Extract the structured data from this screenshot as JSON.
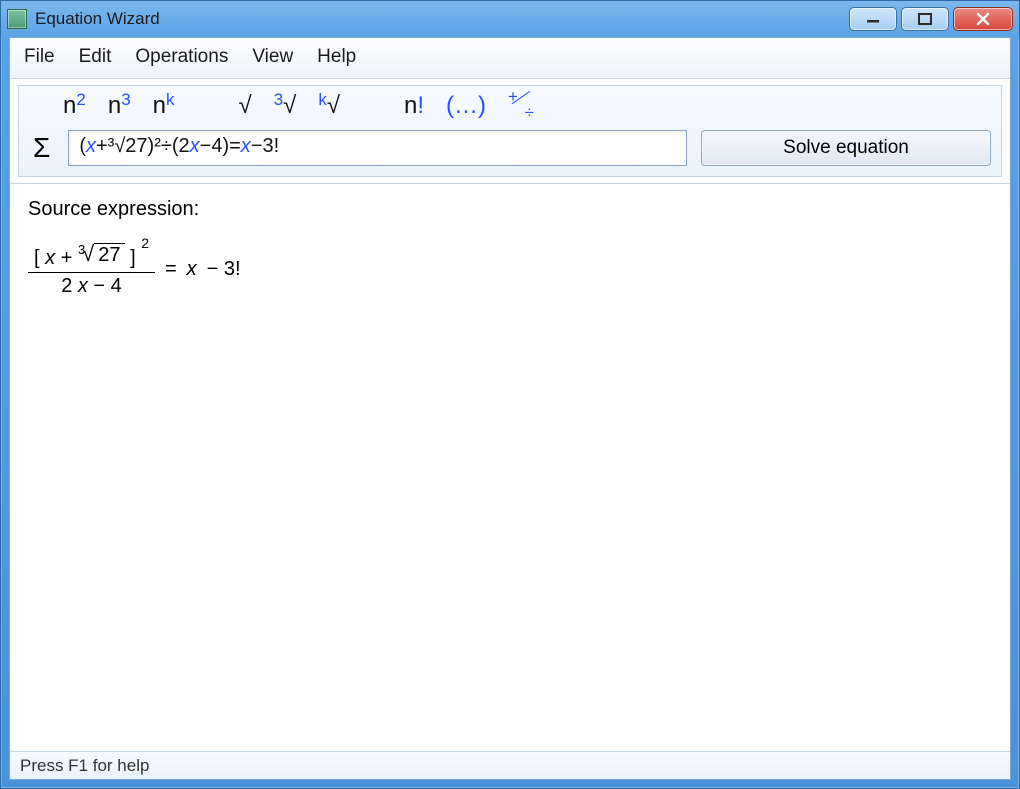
{
  "window": {
    "title": "Equation Wizard"
  },
  "menu": {
    "file": "File",
    "edit": "Edit",
    "operations": "Operations",
    "view": "View",
    "help": "Help"
  },
  "toolbar": {
    "n_square_base": "n",
    "n_square_exp": "2",
    "n_cube_base": "n",
    "n_cube_exp": "3",
    "n_k_base": "n",
    "n_k_exp": "k",
    "sqrt_symbol": "√",
    "cbrt_deg": "3",
    "cbrt_symbol": "√",
    "kroot_deg": "k",
    "kroot_symbol": "√",
    "factorial": "n!",
    "parens": "(…)",
    "ops_plus": "+",
    "ops_div": "÷",
    "ops_minus": "−",
    "sigma": "Σ",
    "solve_label": "Solve equation"
  },
  "input": {
    "pre_x": "(",
    "x1": "x",
    "mid1": "+³√27)²÷(2",
    "x2": "x",
    "mid2": "−4)=",
    "x3": "x",
    "tail": "−3!"
  },
  "content": {
    "source_label": "Source expression:",
    "equation": {
      "num_x": "x",
      "num_plus": " + ",
      "root_deg": "3",
      "root_radicand": "27",
      "outer_exp": "2",
      "den_coeff": "2",
      "den_x": " x",
      "den_minus": " − 4",
      "rhs_eq": " = ",
      "rhs_x": "x",
      "rhs_rest": " − 3!"
    }
  },
  "status": {
    "help": "Press F1 for help"
  }
}
